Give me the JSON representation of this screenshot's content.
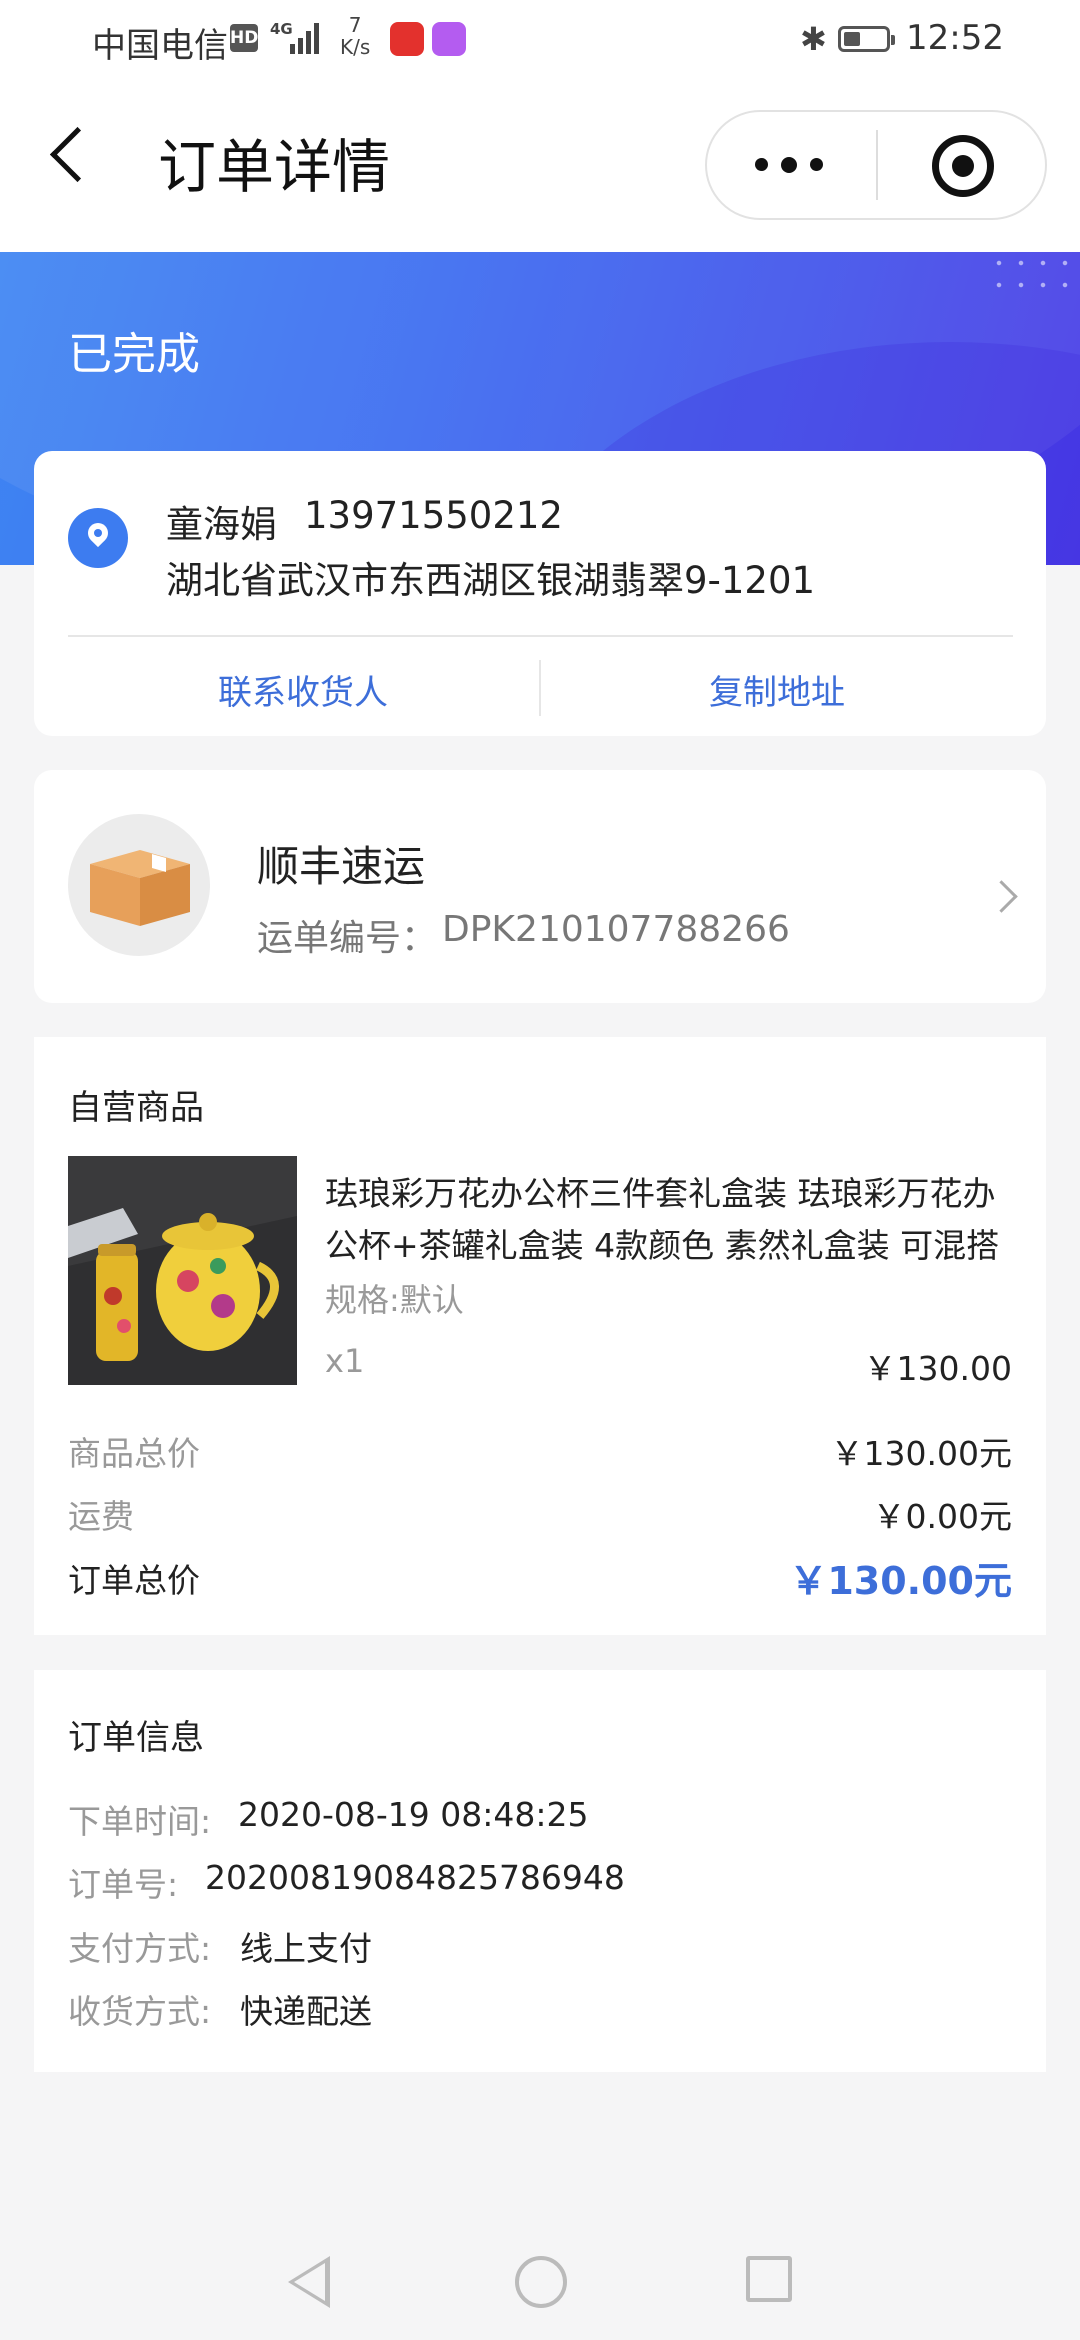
{
  "status_bar": {
    "carrier": "中国电信",
    "hd_badge": "HD",
    "network": "4G",
    "speed_value": "7",
    "speed_unit": "K/s",
    "time": "12:52",
    "battery_level": 0.3
  },
  "nav": {
    "title": "订单详情"
  },
  "order": {
    "status": "已完成"
  },
  "address": {
    "name": "童海娟",
    "phone": "13971550212",
    "address": "湖北省武汉市东西湖区银湖翡翠9-1201",
    "contact_label": "联系收货人",
    "copy_label": "复制地址"
  },
  "shipping": {
    "carrier": "顺丰速运",
    "waybill_label": "运单编号：",
    "waybill_number": "DPK210107788266"
  },
  "goods": {
    "heading": "自营商品",
    "item": {
      "title": "珐琅彩万花办公杯三件套礼盒装 珐琅彩万花办公杯+茶罐礼盒装 4款颜色 素然礼盒装 可混搭",
      "spec": "规格:默认",
      "quantity": "x1",
      "price": "￥130.00"
    },
    "summary": [
      {
        "label": "商品总价",
        "value": "￥130.00元"
      },
      {
        "label": "运费",
        "value": "￥0.00元"
      }
    ],
    "total_label": "订单总价",
    "total_value": "￥130.00元"
  },
  "order_info": {
    "heading": "订单信息",
    "rows": [
      {
        "label": "下单时间:",
        "value": "2020-08-19 08:48:25"
      },
      {
        "label": "订单号:",
        "value": "20200819084825786948"
      },
      {
        "label": "支付方式:",
        "value": "线上支付"
      },
      {
        "label": "收货方式:",
        "value": "快递配送"
      }
    ]
  },
  "colors": {
    "accent": "#3d6ed9",
    "hero_start": "#3f86f3",
    "hero_end": "#4a3be6"
  }
}
